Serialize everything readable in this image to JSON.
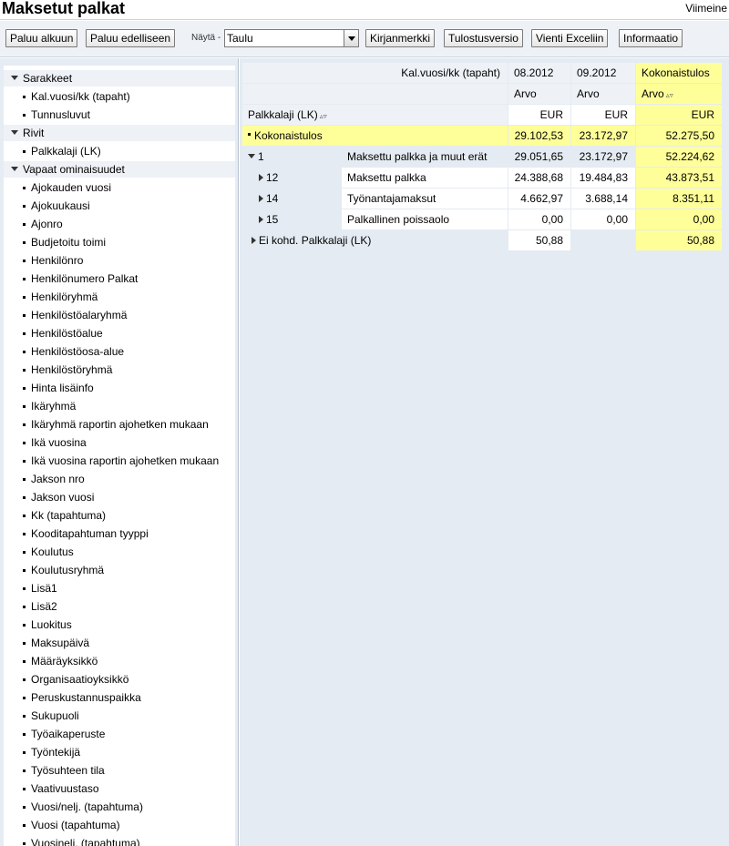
{
  "header": {
    "title": "Maksetut palkat",
    "latest": "Viimeine"
  },
  "toolbar": {
    "back_start": "Paluu alkuun",
    "back_prev": "Paluu edelliseen",
    "show_label": "Näytä -",
    "view_select": "Taulu",
    "bookmark": "Kirjanmerkki",
    "print": "Tulostusversio",
    "excel": "Vienti Exceliin",
    "info": "Informaatio"
  },
  "nav": {
    "groups": [
      {
        "label": "Sarakkeet",
        "items": [
          "Kal.vuosi/kk (tapaht)",
          "Tunnusluvut"
        ]
      },
      {
        "label": "Rivit",
        "items": [
          "Palkkalaji (LK)"
        ]
      },
      {
        "label": "Vapaat ominaisuudet",
        "items": [
          "Ajokauden vuosi",
          "Ajokuukausi",
          "Ajonro",
          "Budjetoitu toimi",
          "Henkilönro",
          "Henkilönumero Palkat",
          "Henkilöryhmä",
          "Henkilöstöalaryhmä",
          "Henkilöstöalue",
          "Henkilöstöosa-alue",
          "Henkilöstöryhmä",
          "Hinta lisäinfo",
          "Ikäryhmä",
          "Ikäryhmä raportin ajohetken mukaan",
          "Ikä vuosina",
          "Ikä vuosina raportin ajohetken mukaan",
          "Jakson nro",
          "Jakson vuosi",
          "Kk (tapahtuma)",
          "Kooditapahtuman tyyppi",
          "Koulutus",
          "Koulutusryhmä",
          "Lisä1",
          "Lisä2",
          "Luokitus",
          "Maksupäivä",
          "Määräyksikkö",
          "Organisaatioyksikkö",
          "Peruskustannuspaikka",
          "Sukupuoli",
          "Työaikaperuste",
          "Työntekijä",
          "Työsuhteen tila",
          "Vaativuustaso",
          "Vuosi/nelj. (tapahtuma)",
          "Vuosi (tapahtuma)",
          "Vuosinelj. (tapahtuma)"
        ]
      }
    ]
  },
  "table": {
    "col_header_label": "Kal.vuosi/kk (tapaht)",
    "columns": [
      "08.2012",
      "09.2012",
      "Kokonaistulos"
    ],
    "measure": "Arvo",
    "unit": "EUR",
    "row_header_label": "Palkkalaji (LK)",
    "rows": [
      {
        "code": "Kokonaistulos",
        "name": "",
        "values": [
          "29.102,53",
          "23.172,97",
          "52.275,50"
        ]
      },
      {
        "code": "1",
        "name": "Maksettu palkka ja muut erät",
        "values": [
          "29.051,65",
          "23.172,97",
          "52.224,62"
        ]
      },
      {
        "code": "12",
        "name": "Maksettu palkka",
        "values": [
          "24.388,68",
          "19.484,83",
          "43.873,51"
        ]
      },
      {
        "code": "14",
        "name": "Työnantajamaksut",
        "values": [
          "4.662,97",
          "3.688,14",
          "8.351,11"
        ]
      },
      {
        "code": "15",
        "name": "Palkallinen poissaolo",
        "values": [
          "0,00",
          "0,00",
          "0,00"
        ]
      },
      {
        "code": "Ei kohd. Palkkalaji (LK)",
        "name": "",
        "values": [
          "50,88",
          "",
          "50,88"
        ]
      }
    ]
  },
  "colors": {
    "total_highlight": "#ffff99",
    "header_bg": "#eef2f6",
    "panel_bg": "#e4ebf2"
  }
}
